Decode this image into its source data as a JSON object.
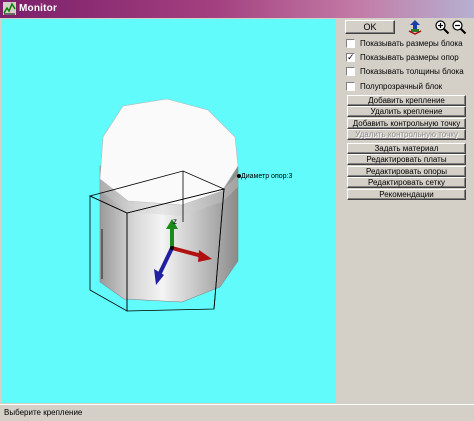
{
  "window": {
    "title": "Monitor"
  },
  "viewport": {
    "background": "#61fbfb",
    "label": "Диаметр опор:3",
    "axis_z": "z"
  },
  "toolbar": {
    "ok_label": "OK",
    "icons": [
      "rotate-icon",
      "zoom-in-icon",
      "zoom-out-icon"
    ]
  },
  "options": [
    {
      "label": "Показывать размеры блока",
      "checked": false
    },
    {
      "label": "Показывать размеры опор",
      "checked": true
    },
    {
      "label": "Показывать толщины блока",
      "checked": false
    },
    {
      "label": "Полупрозрачный блок",
      "checked": false
    }
  ],
  "actions": [
    {
      "label": "Добавить крепление",
      "enabled": true
    },
    {
      "label": "Удалить крепление",
      "enabled": true
    },
    {
      "label": "Добавить контрольную точку",
      "enabled": true
    },
    {
      "label": "Удалить контрольную точку",
      "enabled": false
    },
    {
      "label": "Задать материал",
      "enabled": true
    },
    {
      "label": "Редактировать платы",
      "enabled": true
    },
    {
      "label": "Редактировать опоры",
      "enabled": true
    },
    {
      "label": "Редактировать сетку",
      "enabled": true
    },
    {
      "label": "Рекомендации",
      "enabled": true
    }
  ],
  "status": {
    "text": "Выберите крепление"
  }
}
